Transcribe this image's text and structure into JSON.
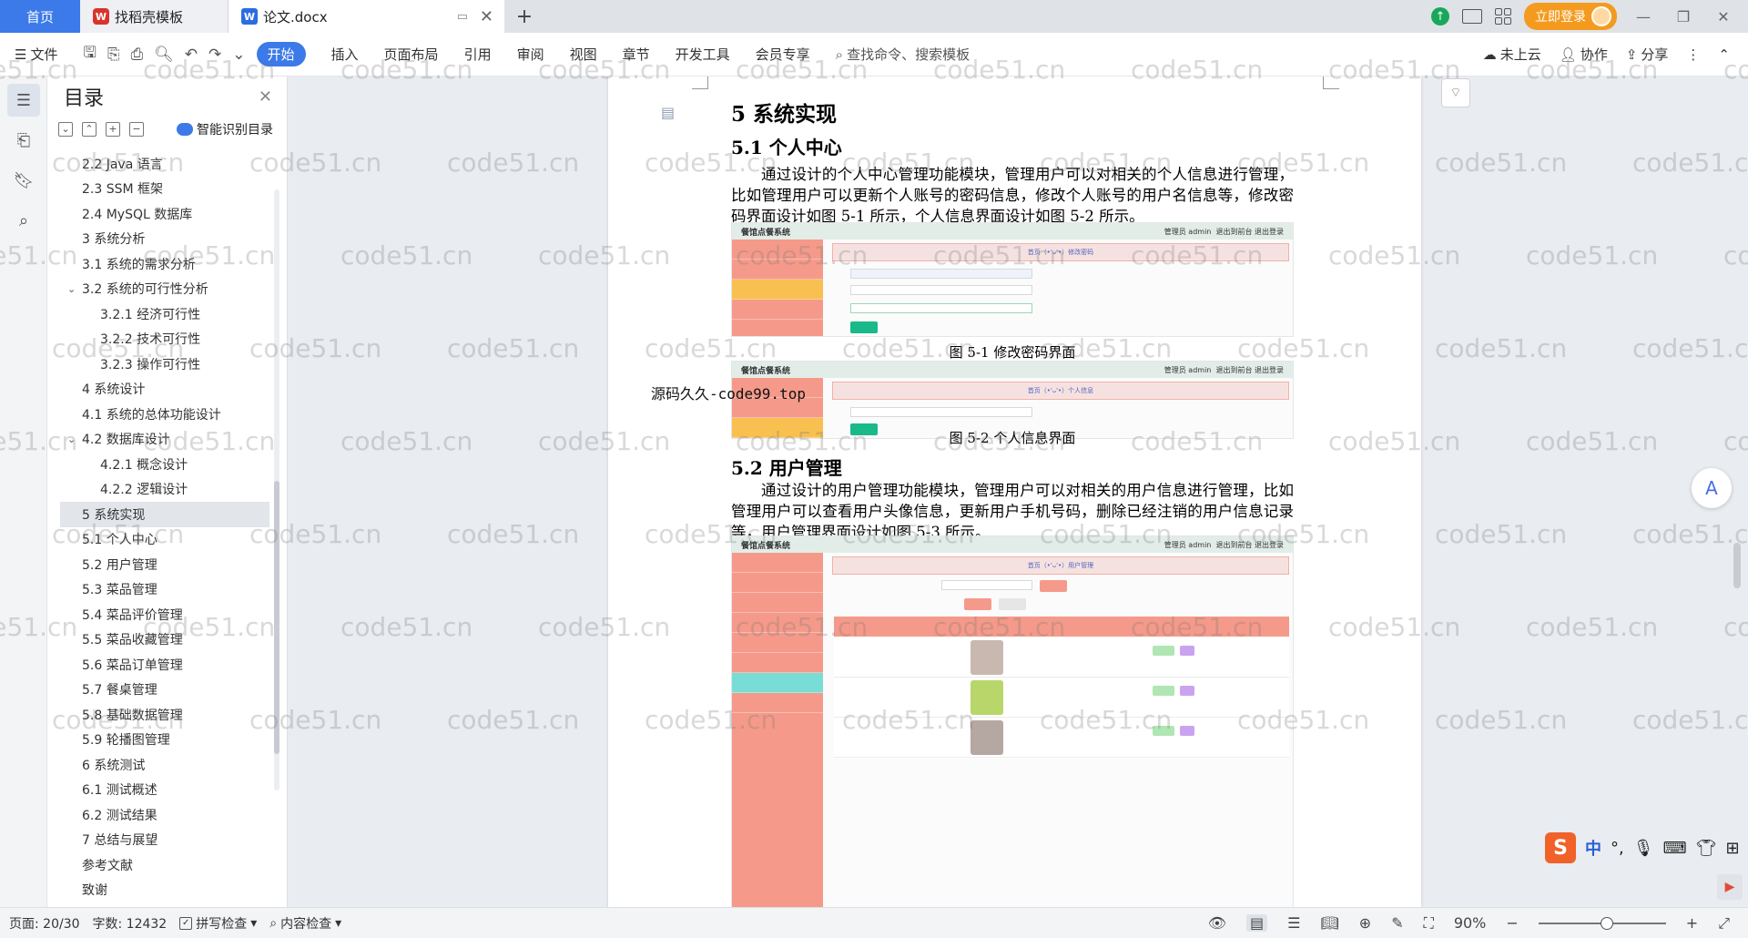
{
  "tabs": {
    "home": "首页",
    "templates": "找稻壳模板",
    "document": "论文.docx"
  },
  "titlebar": {
    "login": "立即登录"
  },
  "ribbon": {
    "file": "文件",
    "tabs": [
      "开始",
      "插入",
      "页面布局",
      "引用",
      "审阅",
      "视图",
      "章节",
      "开发工具",
      "会员专享"
    ],
    "search": "查找命令、搜索模板",
    "cloud": "未上云",
    "collab": "协作",
    "share": "分享"
  },
  "toc": {
    "title": "目录",
    "smart": "智能识别目录",
    "items": [
      {
        "label": "2.2 Java 语言",
        "level": 1
      },
      {
        "label": "2.3 SSM 框架",
        "level": 1
      },
      {
        "label": "2.4 MySQL 数据库",
        "level": 1
      },
      {
        "label": "3 系统分析",
        "level": 1
      },
      {
        "label": "3.1 系统的需求分析",
        "level": 1
      },
      {
        "label": "3.2 系统的可行性分析",
        "level": 1,
        "expanded": true
      },
      {
        "label": "3.2.1 经济可行性",
        "level": 2
      },
      {
        "label": "3.2.2 技术可行性",
        "level": 2
      },
      {
        "label": "3.2.3 操作可行性",
        "level": 2
      },
      {
        "label": "4 系统设计",
        "level": 1
      },
      {
        "label": "4.1 系统的总体功能设计",
        "level": 1
      },
      {
        "label": "4.2 数据库设计",
        "level": 1,
        "expanded": true
      },
      {
        "label": "4.2.1 概念设计",
        "level": 2
      },
      {
        "label": "4.2.2 逻辑设计",
        "level": 2
      },
      {
        "label": "5 系统实现",
        "level": 1,
        "current": true
      },
      {
        "label": "5.1 个人中心",
        "level": 1
      },
      {
        "label": "5.2 用户管理",
        "level": 1
      },
      {
        "label": "5.3 菜品管理",
        "level": 1
      },
      {
        "label": "5.4 菜品评价管理",
        "level": 1
      },
      {
        "label": "5.5 菜品收藏管理",
        "level": 1
      },
      {
        "label": "5.6 菜品订单管理",
        "level": 1
      },
      {
        "label": "5.7 餐桌管理",
        "level": 1
      },
      {
        "label": "5.8 基础数据管理",
        "level": 1
      },
      {
        "label": "5.9 轮播图管理",
        "level": 1
      },
      {
        "label": "6 系统测试",
        "level": 1
      },
      {
        "label": "6.1 测试概述",
        "level": 1
      },
      {
        "label": "6.2 测试结果",
        "level": 1
      },
      {
        "label": "7 总结与展望",
        "level": 1
      },
      {
        "label": "参考文献",
        "level": 1
      },
      {
        "label": "致谢",
        "level": 1
      }
    ]
  },
  "doc": {
    "h1": "5 系统实现",
    "h2_1": "5.1 个人中心",
    "p1": "通过设计的个人中心管理功能模块，管理用户可以对相关的个人信息进行管理，比如管理用户可以更新个人账号的密码信息，修改个人账号的用户名信息等，修改密码界面设计如图 5-1 所示，个人信息界面设计如图 5-2 所示。",
    "caption1": "图 5-1 修改密码界面",
    "caption2": "图 5-2 个人信息界面",
    "h2_2": "5.2 用户管理",
    "p2": "通过设计的用户管理功能模块，管理用户可以对相关的用户信息进行管理，比如管理用户可以查看用户头像信息，更新用户手机号码，删除已经注销的用户信息记录等，用户管理界面设计如图 5-3 所示。",
    "overlay": "源码久久-code99.top",
    "app_title": "餐馆点餐系统",
    "app_user": "管理员 admin",
    "app_links": "退出到前台    退出登录",
    "breadcrumb1": "首页（•'ᴗ'•）修改密码",
    "breadcrumb2": "首页（•'ᴗ'•）个人信息",
    "breadcrumb3": "首页（•'ᴗ'•）用户管理"
  },
  "watermark": "code51.cn",
  "status": {
    "page": "页面: 20/30",
    "words": "字数: 12432",
    "spell": "拼写检查",
    "content": "内容检查",
    "zoom": "90%"
  },
  "ime": {
    "lang": "中"
  }
}
